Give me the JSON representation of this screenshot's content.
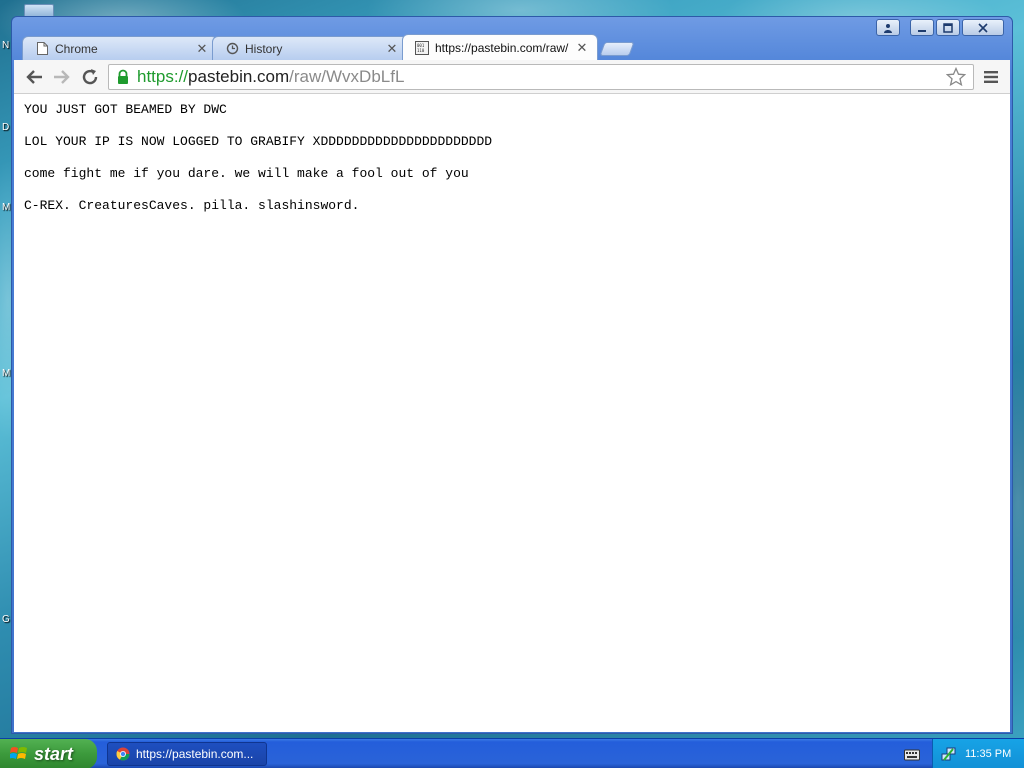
{
  "desktop": {
    "edge_letters": [
      "N",
      "D",
      "M",
      "M",
      "G"
    ]
  },
  "window": {
    "controls": {
      "user": "user-icon",
      "minimize": "minimize-icon",
      "maximize": "maximize-icon",
      "close": "close-icon"
    }
  },
  "tabs": [
    {
      "title": "Chrome",
      "icon": "page-icon",
      "active": false
    },
    {
      "title": "History",
      "icon": "history-icon",
      "active": false
    },
    {
      "title": "https://pastebin.com/raw/",
      "icon": "pastebin-icon",
      "active": true
    }
  ],
  "omnibox": {
    "scheme": "https://",
    "host": "pastebin.com",
    "path": "/raw/WvxDbLfL"
  },
  "content": {
    "lines": [
      "YOU JUST GOT BEAMED BY DWC",
      "LOL YOUR IP IS NOW LOGGED TO GRABIFY XDDDDDDDDDDDDDDDDDDDDDD",
      "come fight me if you dare. we will make a fool out of you",
      "C-REX. CreaturesCaves. pilla. slashinsword."
    ]
  },
  "taskbar": {
    "start_label": "start",
    "task_item_label": "https://pastebin.com...",
    "clock": "11:35 PM"
  },
  "colors": {
    "url_scheme": "#1f9b2e",
    "taskbar": "#245edb",
    "start": "#3c9a3c",
    "tray": "#1290d6"
  }
}
